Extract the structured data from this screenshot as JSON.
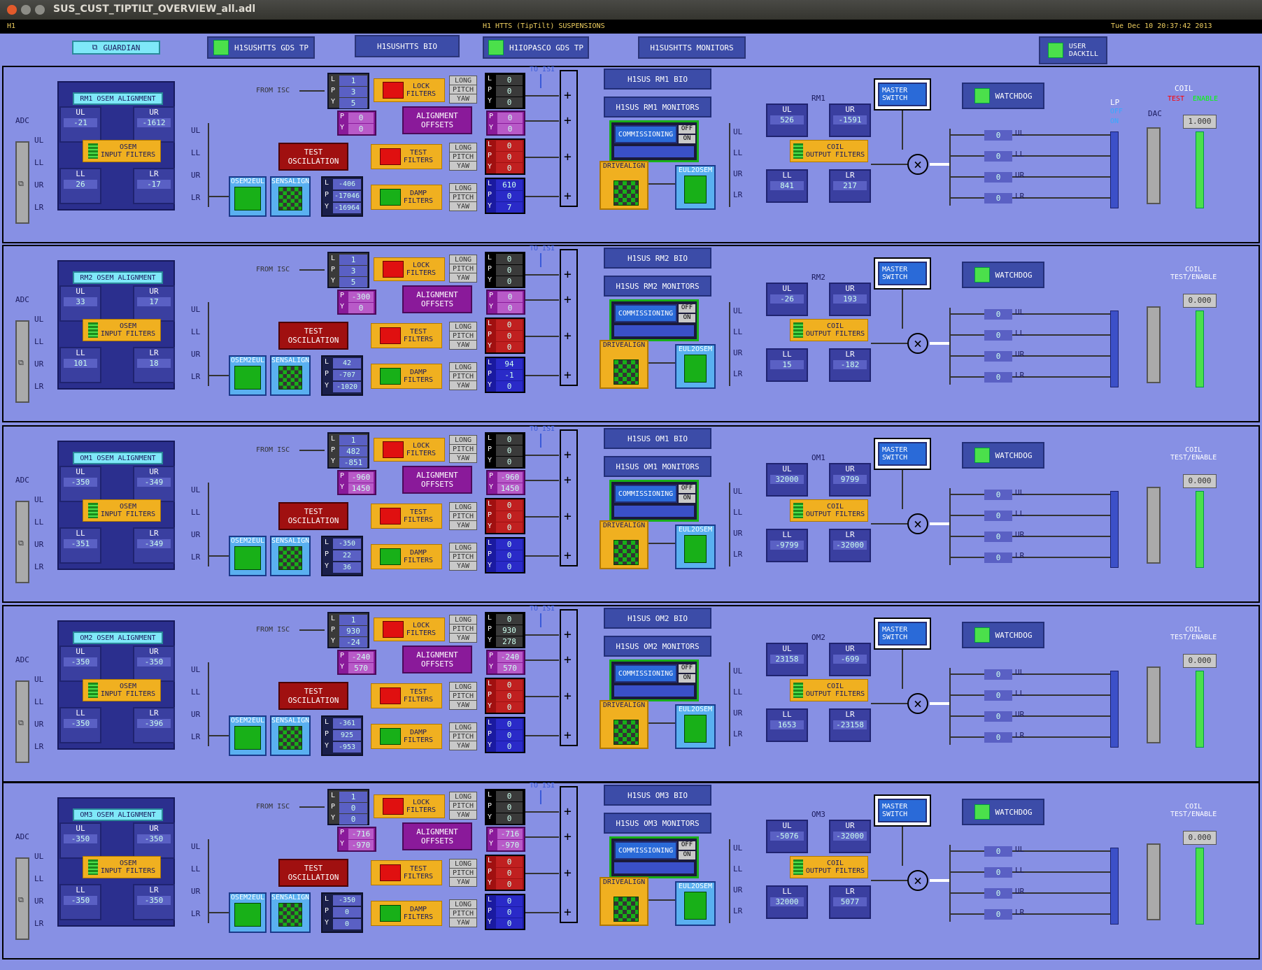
{
  "window": {
    "title": "SUS_CUST_TIPTILT_OVERVIEW_all.adl"
  },
  "header": {
    "left": "H1",
    "center": "H1 HTTS (TipTilt) SUSPENSIONS",
    "right": "Tue Dec 10 20:37:42 2013"
  },
  "topbar": {
    "guardian": "GUARDIAN",
    "gds_tp": "H1SUSHTTS GDS TP",
    "bio": "H1SUSHTTS BIO",
    "iopasco": "H1IOPASCO GDS TP",
    "monitors": "H1SUSHTTS MONITORS",
    "user_dackill": "USER\nDACKILL"
  },
  "labels": {
    "adc": "ADC",
    "dac": "DAC",
    "lp": "LP",
    "lp_off": "OFF",
    "lp_on": "ON",
    "coil": "COIL",
    "test": "TEST",
    "enable": "ENABLE",
    "coil_test_enable": "COIL\nTEST/ENABLE",
    "from_isc": "FROM ISC",
    "to_isi": "TO ISI",
    "osem_input_filters": "OSEM\nINPUT FILTERS",
    "lock_filters": "LOCK\nFILTERS",
    "alignment_offsets": "ALIGNMENT\nOFFSETS",
    "test_oscillation": "TEST\nOSCILLATION",
    "test_filters": "TEST\nFILTERS",
    "damp_filters": "DAMP\nFILTERS",
    "osem2eul": "OSEM2EUL",
    "sensalign": "SENSALIGN",
    "drivealign": "DRIVEALIGN",
    "eul2osem": "EUL2OSEM",
    "commissioning": "COMMISSIONING",
    "off": "OFF",
    "on": "ON",
    "coil_output_filters": "COIL\nOUTPUT FILTERS",
    "master_switch": "MASTER\nSWITCH",
    "watchdog": "WATCHDOG",
    "long": "LONG",
    "pitch": "PITCH",
    "yaw": "YAW",
    "ul": "UL",
    "ur": "UR",
    "ll": "LL",
    "lr": "LR",
    "l": "L",
    "p": "P",
    "y": "Y"
  },
  "colors": {
    "background": "#8790e4",
    "panel": "#3c4ca8",
    "yellow": "#f0b020",
    "purple": "#8a1a9a",
    "green": "#4be04b",
    "red": "#e01010"
  },
  "sections": [
    {
      "name": "RM1",
      "osem_title": "RM1 OSEM ALIGNMENT",
      "bio": "H1SUS RM1 BIO",
      "monitors": "H1SUS RM1 MONITORS",
      "osem": {
        "ul": "-21",
        "ur": "-1612",
        "ll": "26",
        "lr": "-17"
      },
      "lock": {
        "l": "1",
        "p": "3",
        "y": "5"
      },
      "lock_out": {
        "l": "0",
        "p": "0",
        "y": "0"
      },
      "align": {
        "p": "0",
        "y": "0"
      },
      "align_out": {
        "p": "0",
        "y": "0"
      },
      "test_out": {
        "l": "0",
        "p": "0",
        "y": "0"
      },
      "damp_in": {
        "l": "-406",
        "p": "-17046",
        "y": "-16964"
      },
      "damp_out": {
        "l": "610",
        "p": "0",
        "y": "7"
      },
      "coil_out": {
        "ul": "526",
        "ur": "-1591",
        "ll": "841",
        "lr": "217"
      },
      "dac": {
        "ul": "0",
        "ll": "0",
        "ur": "0",
        "lr": "0"
      },
      "coil_value": "1.000"
    },
    {
      "name": "RM2",
      "osem_title": "RM2 OSEM ALIGNMENT",
      "bio": "H1SUS RM2 BIO",
      "monitors": "H1SUS RM2 MONITORS",
      "osem": {
        "ul": "33",
        "ur": "17",
        "ll": "101",
        "lr": "18"
      },
      "lock": {
        "l": "1",
        "p": "3",
        "y": "5"
      },
      "lock_out": {
        "l": "0",
        "p": "0",
        "y": "0"
      },
      "align": {
        "p": "-300",
        "y": "0"
      },
      "align_out": {
        "p": "0",
        "y": "0"
      },
      "test_out": {
        "l": "0",
        "p": "0",
        "y": "0"
      },
      "damp_in": {
        "l": "42",
        "p": "-707",
        "y": "-1020"
      },
      "damp_out": {
        "l": "94",
        "p": "-1",
        "y": "0"
      },
      "coil_out": {
        "ul": "-26",
        "ur": "193",
        "ll": "15",
        "lr": "-182"
      },
      "dac": {
        "ul": "0",
        "ll": "0",
        "ur": "0",
        "lr": "0"
      },
      "coil_value": "0.000"
    },
    {
      "name": "OM1",
      "osem_title": "OM1 OSEM ALIGNMENT",
      "bio": "H1SUS OM1 BIO",
      "monitors": "H1SUS OM1 MONITORS",
      "osem": {
        "ul": "-350",
        "ur": "-349",
        "ll": "-351",
        "lr": "-349"
      },
      "lock": {
        "l": "1",
        "p": "482",
        "y": "-851"
      },
      "lock_out": {
        "l": "0",
        "p": "0",
        "y": "0"
      },
      "align": {
        "p": "-960",
        "y": "1450"
      },
      "align_out": {
        "p": "-960",
        "y": "1450"
      },
      "test_out": {
        "l": "0",
        "p": "0",
        "y": "0"
      },
      "damp_in": {
        "l": "-350",
        "p": "22",
        "y": "36"
      },
      "damp_out": {
        "l": "0",
        "p": "0",
        "y": "0"
      },
      "coil_out": {
        "ul": "32000",
        "ur": "9799",
        "ll": "-9799",
        "lr": "-32000"
      },
      "dac": {
        "ul": "0",
        "ll": "0",
        "ur": "0",
        "lr": "0"
      },
      "coil_value": "0.000"
    },
    {
      "name": "OM2",
      "osem_title": "OM2 OSEM ALIGNMENT",
      "bio": "H1SUS OM2 BIO",
      "monitors": "H1SUS OM2 MONITORS",
      "osem": {
        "ul": "-350",
        "ur": "-350",
        "ll": "-350",
        "lr": "-396"
      },
      "lock": {
        "l": "1",
        "p": "930",
        "y": "-24"
      },
      "lock_out": {
        "l": "0",
        "p": "930",
        "y": "278"
      },
      "align": {
        "p": "-240",
        "y": "570"
      },
      "align_out": {
        "p": "-240",
        "y": "570"
      },
      "test_out": {
        "l": "0",
        "p": "0",
        "y": "0"
      },
      "damp_in": {
        "l": "-361",
        "p": "925",
        "y": "-953"
      },
      "damp_out": {
        "l": "0",
        "p": "0",
        "y": "0"
      },
      "coil_out": {
        "ul": "23158",
        "ur": "-699",
        "ll": "1653",
        "lr": "-23158"
      },
      "dac": {
        "ul": "0",
        "ll": "0",
        "ur": "0",
        "lr": "0"
      },
      "coil_value": "0.000"
    },
    {
      "name": "OM3",
      "osem_title": "OM3 OSEM ALIGNMENT",
      "bio": "H1SUS OM3 BIO",
      "monitors": "H1SUS OM3 MONITORS",
      "osem": {
        "ul": "-350",
        "ur": "-350",
        "ll": "-350",
        "lr": "-350"
      },
      "lock": {
        "l": "1",
        "p": "0",
        "y": "0"
      },
      "lock_out": {
        "l": "0",
        "p": "0",
        "y": "0"
      },
      "align": {
        "p": "-716",
        "y": "-970"
      },
      "align_out": {
        "p": "-716",
        "y": "-970"
      },
      "test_out": {
        "l": "0",
        "p": "0",
        "y": "0"
      },
      "damp_in": {
        "l": "-350",
        "p": "0",
        "y": "0"
      },
      "damp_out": {
        "l": "0",
        "p": "0",
        "y": "0"
      },
      "coil_out": {
        "ul": "-5076",
        "ur": "-32000",
        "ll": "32000",
        "lr": "5077"
      },
      "dac": {
        "ul": "0",
        "ll": "0",
        "ur": "0",
        "lr": "0"
      },
      "coil_value": "0.000"
    }
  ]
}
